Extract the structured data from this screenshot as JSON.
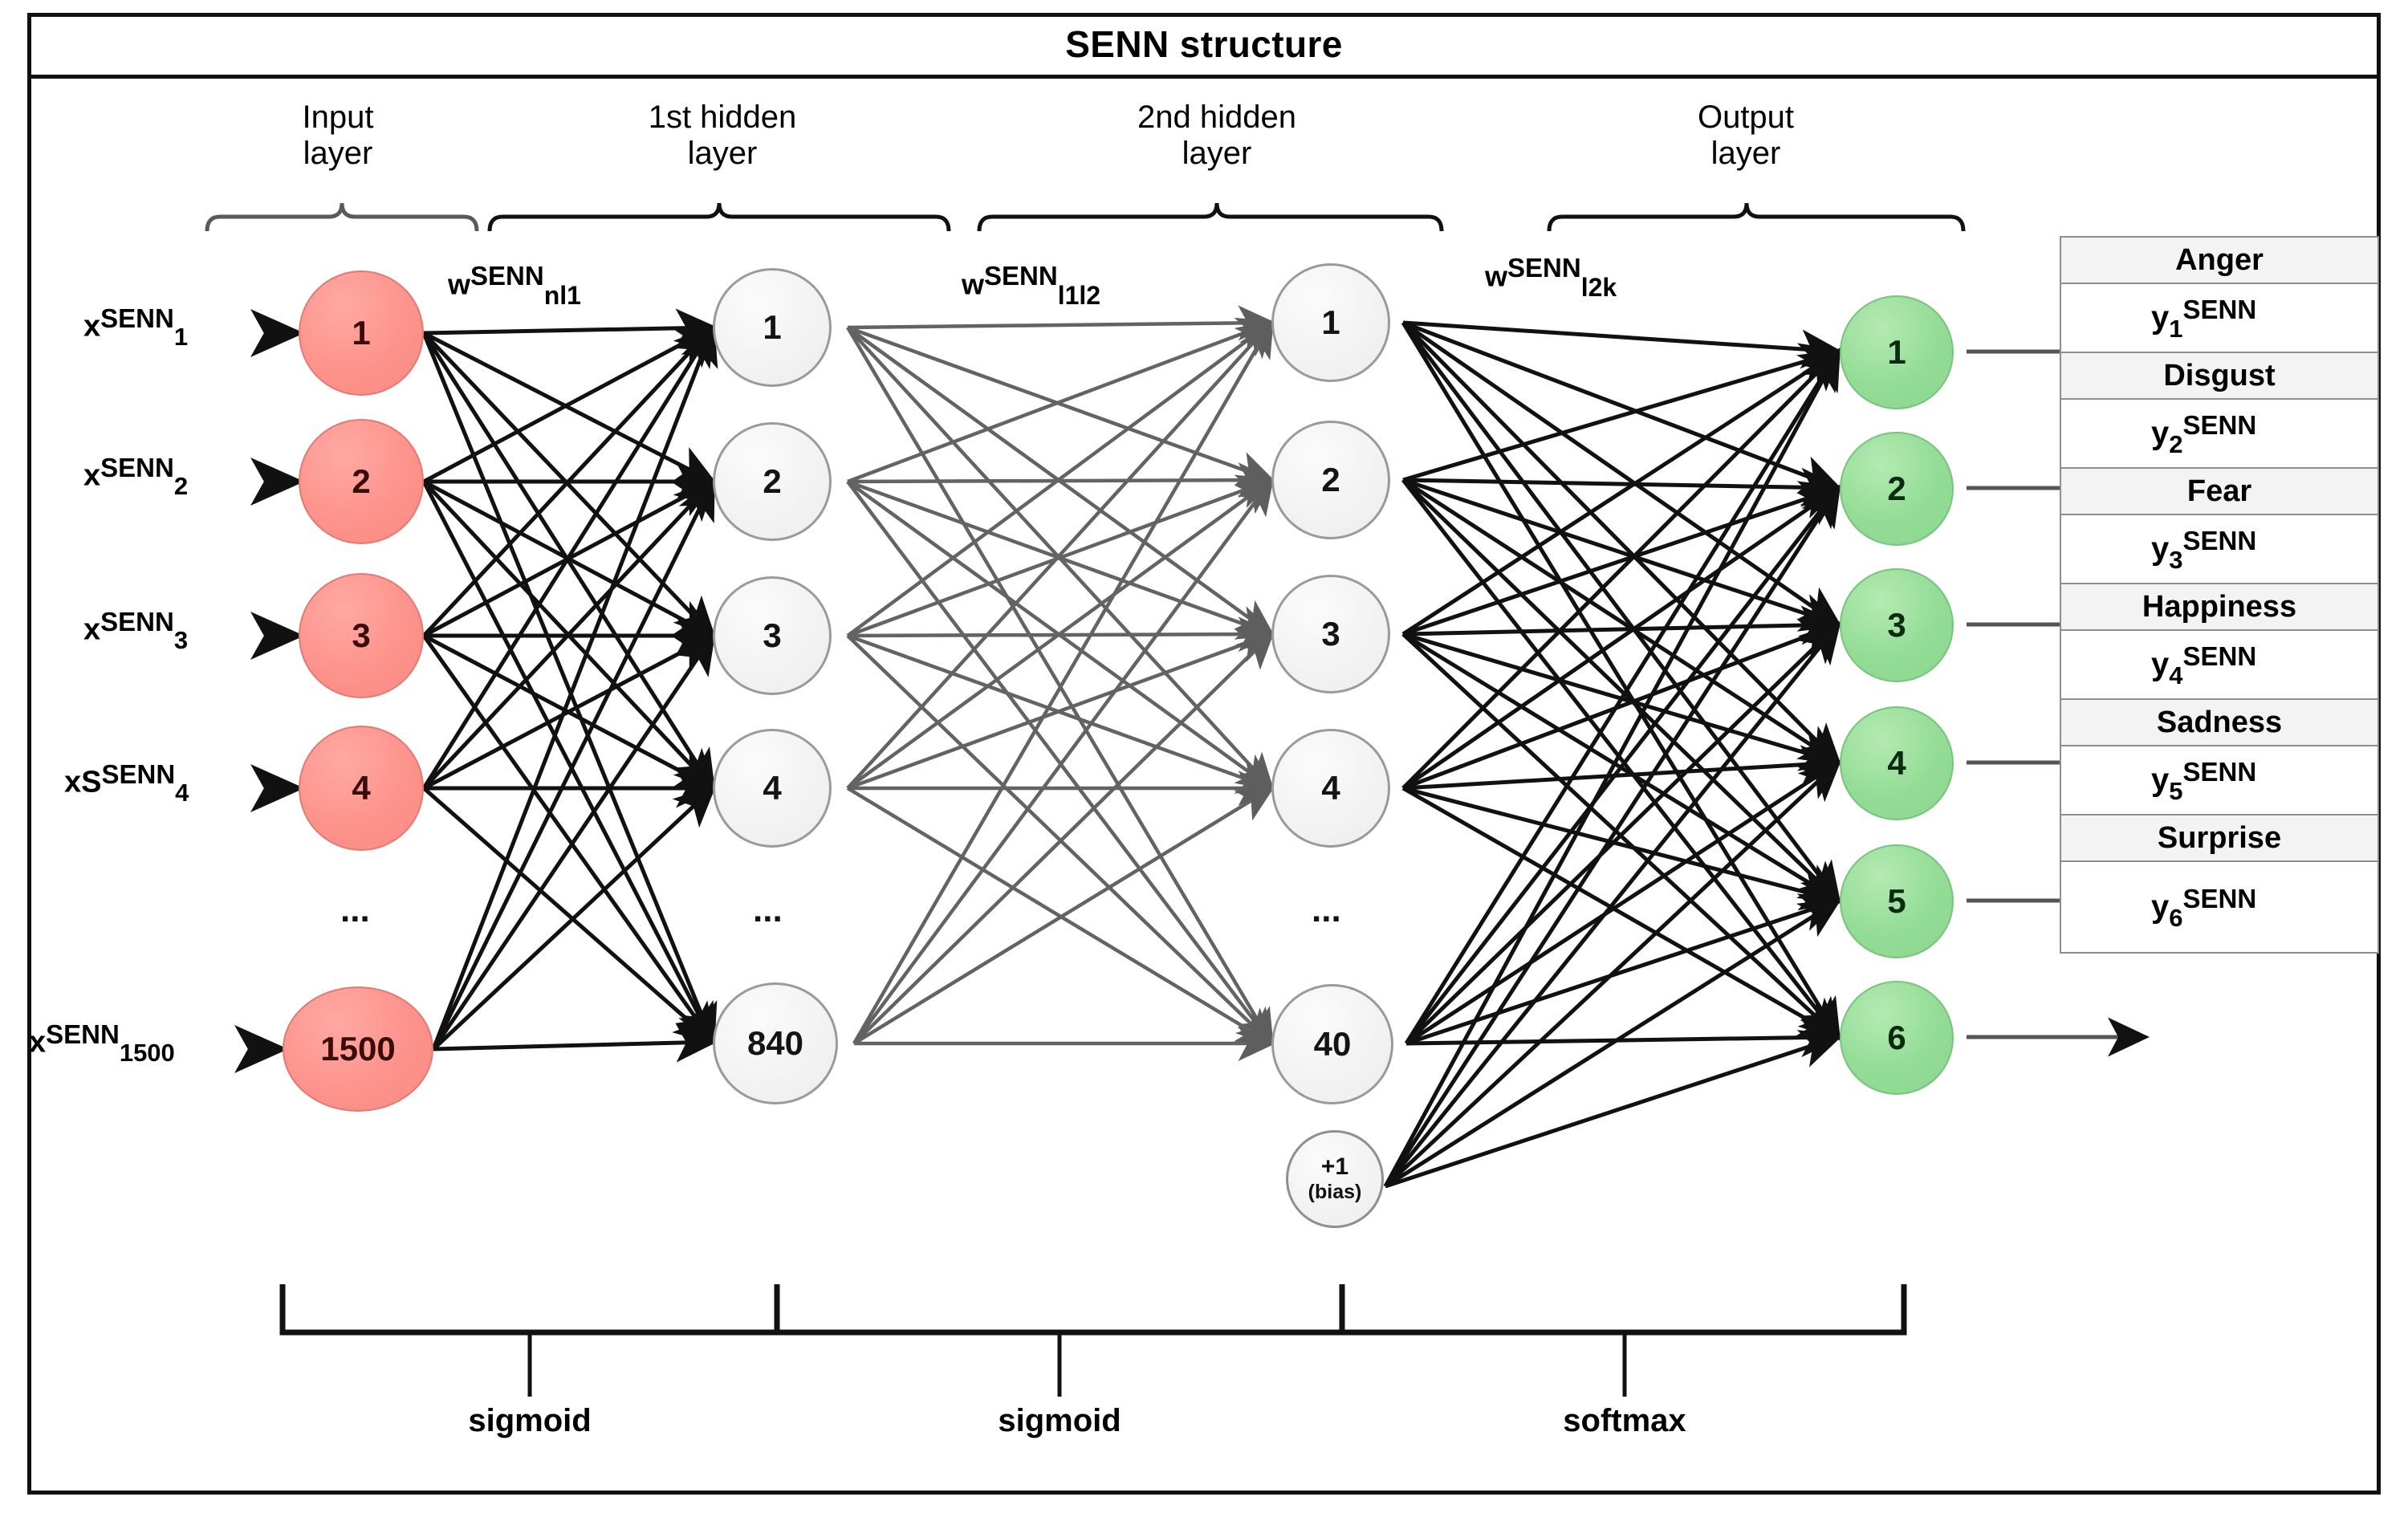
{
  "figure": {
    "title": "SENN structure"
  },
  "layers": {
    "headers": [
      {
        "line1": "Input",
        "line2": "layer"
      },
      {
        "line1": "1st hidden",
        "line2": "layer"
      },
      {
        "line1": "2nd hidden",
        "line2": "layer"
      },
      {
        "line1": "Output",
        "line2": "layer"
      }
    ]
  },
  "input_layer": {
    "nodes": [
      "1",
      "2",
      "3",
      "4",
      "1500"
    ],
    "ellipsis": "...",
    "labels": [
      {
        "base": "x",
        "sup": "SENN",
        "sub": "1"
      },
      {
        "base": "x",
        "sup": "SENN",
        "sub": "2"
      },
      {
        "base": "x",
        "sup": "SENN",
        "sub": "3"
      },
      {
        "base": "xS",
        "sup": "SENN",
        "sub": "4"
      },
      {
        "base": "x",
        "sup": "SENN",
        "sub": "1500"
      }
    ]
  },
  "hidden_layer_1": {
    "nodes": [
      "1",
      "2",
      "3",
      "4",
      "840"
    ],
    "ellipsis": "..."
  },
  "hidden_layer_2": {
    "nodes": [
      "1",
      "2",
      "3",
      "4",
      "40"
    ],
    "ellipsis": "...",
    "bias": {
      "line1": "+1",
      "line2": "(bias)"
    }
  },
  "output_layer": {
    "nodes": [
      "1",
      "2",
      "3",
      "4",
      "5",
      "6"
    ]
  },
  "weights": [
    {
      "base": "w",
      "sup": "SENN",
      "sub": "nl1"
    },
    {
      "base": "w",
      "sup": "SENN",
      "sub": "l1l2"
    },
    {
      "base": "w",
      "sup": "SENN",
      "sub": "l2k"
    }
  ],
  "outputs": [
    {
      "emotion": "Anger",
      "base": "y",
      "sub": "1",
      "sup": "SENN"
    },
    {
      "emotion": "Disgust",
      "base": "y",
      "sub": "2",
      "sup": "SENN"
    },
    {
      "emotion": "Fear",
      "base": "y",
      "sub": "3",
      "sup": "SENN"
    },
    {
      "emotion": "Happiness",
      "base": "y",
      "sub": "4",
      "sup": "SENN"
    },
    {
      "emotion": "Sadness",
      "base": "y",
      "sub": "5",
      "sup": "SENN"
    },
    {
      "emotion": "Surprise",
      "base": "y",
      "sub": "6",
      "sup": "SENN"
    }
  ],
  "activations": [
    "sigmoid",
    "sigmoid",
    "softmax"
  ],
  "colors": {
    "input_node": "#fd938c",
    "hidden_node": "#f0f0f0",
    "output_node": "#93dc96",
    "frame": "#111111",
    "table_header_bg": "#f3f3f3",
    "edge_dark": "#111111",
    "edge_gray": "#636363"
  }
}
